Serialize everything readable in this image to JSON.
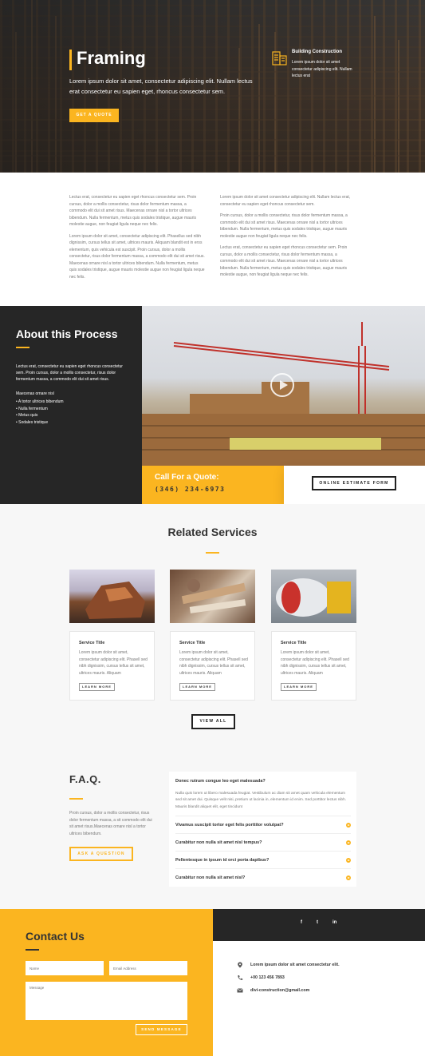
{
  "hero": {
    "title": "Framing",
    "description": "Lorem ipsum dolor sit amet, consectetur adipiscing elit. Nullam lectus erat consectetur eu sapien eget, rhoncus consectetur sem.",
    "button_label": "GET A QUOTE",
    "feature": {
      "title": "Building Construction",
      "text": "Lorem ipsum dolor sit amet consectetur adipiscing elit. Nullam lectus erat"
    }
  },
  "intro": {
    "left": [
      "Lectus erat, consectetur eu sapien eget rhoncus consectetur sem. Proin cursus, dolor a mollis consectetur, risus dolor fermentum massa, a commodo elit dui sit amet risus. Maecenas ornare nisl a tortor ultrices bibendum. Nulla fermentum, metus quis sodales tristique, augue mauris molestie augue, non feugiat ligula neque nec felis.",
      "Lorem ipsum dolor sit amet, consectetur adipiscing elit. Phasellus sed nibh dignissim, cursus tellus sit amet, ultrices mauris. Aliquam blandit est in eros elementum, quis vehicula est suscipit. Proin cursus, dolor a mollis consectetur, risus dolor fermentum massa, a commodo elit dui sit amet risus. Maecenas ornare nisl a tortor ultrices bibendum. Nulla fermentum, metus quis sodales tristique, augue mauris molestie augue non feugiat ligula neque nec felis."
    ],
    "right": [
      "Lorem ipsum dolor sit amet consectetur adipiscing elit. Nullam lectus erat, consectetur eu sapien eget rhoncus consectetur sem.",
      "Proin cursus, dolor a mollis consectetur, risus dolor fermentum massa, a commodo elit dui sit amet risus. Maecenas ornare nisl a tortor ultrices bibendum. Nulla fermentum, metus quis sodales tristique, augue mauris molestie augue non feugiat ligula neque nec felis.",
      "Lectus erat, consectetur eu sapien eget rhoncus consectetur sem. Proin cursus, dolor a mollis consectetur, risus dolor fermentum massa, a commodo elit dui sit amet risus. Maecenas ornare nisl a tortor ultrices bibendum. Nulla fermentum, metus quis sodales tristique, augue mauris molestie augue, non feugiat ligula neque nec felis."
    ]
  },
  "about": {
    "title": "About this Process",
    "text": "Lectus erat, consectetur eu sapien eget rhoncus consectetur sem. Proin cursus, dolor a mollis consectetur, risus dolor fermentum massa, a commodo elit dui sit amet risus.",
    "list_intro": "Maecenas ornare nisl",
    "list": [
      "A tortor ultrices bibendum",
      "Nulla fermentum",
      "Metus quis",
      "Sodales tristique"
    ]
  },
  "quote": {
    "title": "Call For a Quote:",
    "phone": "(346) 234-6973",
    "estimate_button": "ONLINE ESTIMATE FORM"
  },
  "services": {
    "title": "Related Services",
    "items": [
      {
        "title": "Service Title",
        "text": "Lorem ipsum dolor sit amet, consectetur adipiscing elit. Phasell sed nibh dignissim, cursus tellus sit amet, ultrices mauris. Aliquam",
        "button": "LEARN MORE"
      },
      {
        "title": "Service Title",
        "text": "Lorem ipsum dolor sit amet, consectetur adipiscing elit. Phasell sed nibh dignissim, cursus tellus sit amet, ultrices mauris. Aliquam",
        "button": "LEARN MORE"
      },
      {
        "title": "Service Title",
        "text": "Lorem ipsum dolor sit amet, consectetur adipiscing elit. Phasell sed nibh dignissim, cursus tellus sit amet, ultrices mauris. Aliquam",
        "button": "LEARN MORE"
      }
    ],
    "view_all": "VIEW ALL"
  },
  "faq": {
    "title": "F.A.Q.",
    "text": "Proin cursus, dolor a mollis consectetur, risus dolor fermentum massa, a sit commodo elit dui sit amet risus.Maecenas ornare nisl a tortor ultrices bibendum.",
    "ask_button": "ASK A QUESTION",
    "open_question": "Donec rutrum congue leo eget malesuada?",
    "open_answer": "Nulla quis lorem ut libero malesuada feugiat. Vestibulum ac diam sit amet quam vehicula elementum sed sit amet dui. Quisque velit nisi, pretium ut lacinia in, elementum id enim. Sed porttitor lectus nibh. Mauris blandit aliquet elit, eget tincidunt",
    "questions": [
      "Vivamus suscipit tortor eget felis porttitor volutpat?",
      "Curabitur non nulla sit amet nisl tempus?",
      "Pellentesque in ipsum id orci porta dapibus?",
      "Curabitur non nulla sit amet nisl?"
    ]
  },
  "contact": {
    "title": "Contact Us",
    "name_placeholder": "Name",
    "email_placeholder": "Email Address",
    "message_placeholder": "Message",
    "send_button": "SEND MESSAGE",
    "social": [
      "f",
      "t",
      "in"
    ],
    "address": "Lorem ipsum dolor sit amet consectetur elit.",
    "phone": "+00 123 456 7893",
    "email": "divi-construction@gmail.com"
  },
  "colors": {
    "accent": "#fbb520",
    "dark": "#262626",
    "light_bg": "#f7f7f7"
  },
  "icons": [
    "building-icon",
    "play-icon",
    "arrow-circle-icon",
    "location-icon",
    "phone-icon",
    "mail-icon",
    "facebook-icon",
    "twitter-icon",
    "linkedin-icon"
  ]
}
